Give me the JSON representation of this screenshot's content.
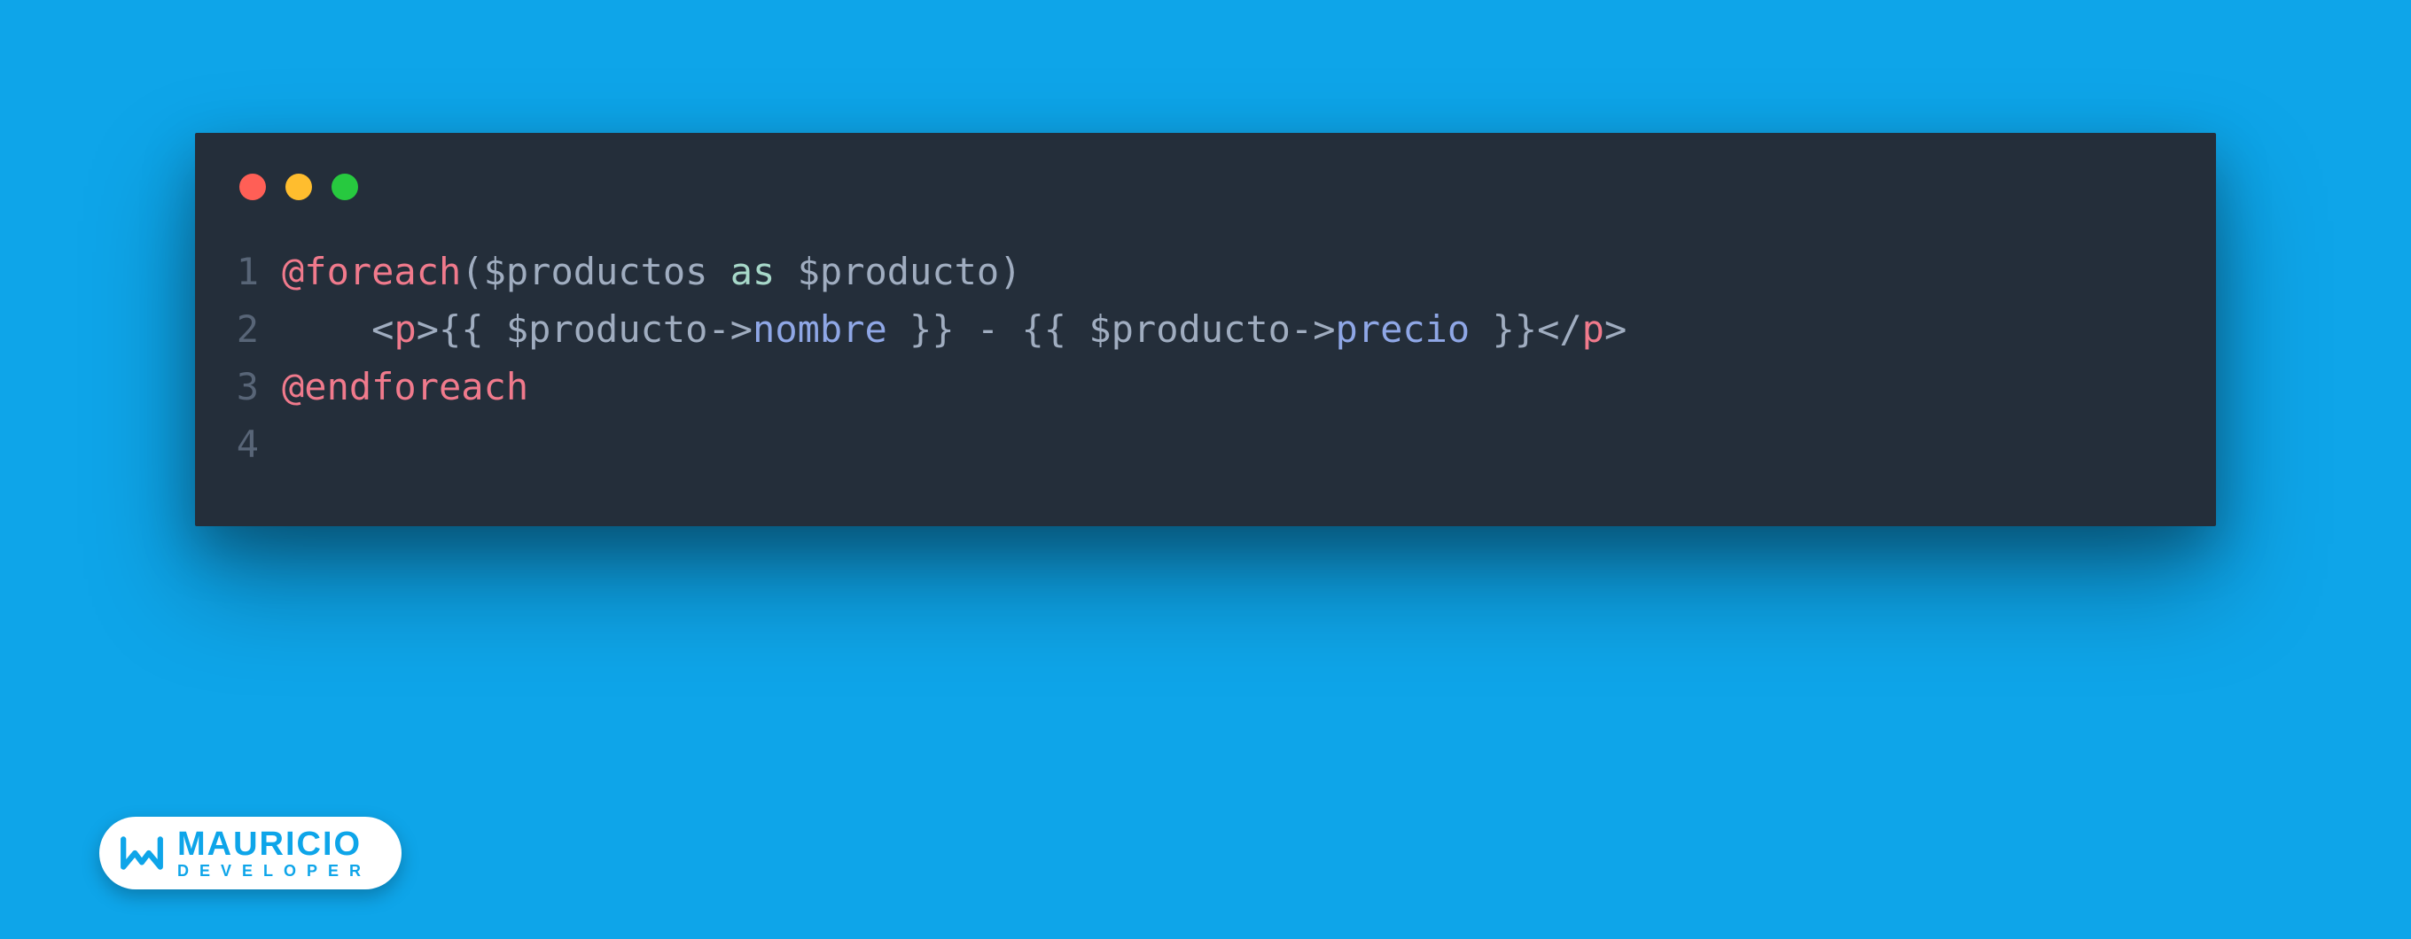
{
  "colors": {
    "page_bg": "#0ea5e9",
    "window_bg": "#242e3a",
    "traffic_red": "#ff5f56",
    "traffic_yellow": "#ffbd2e",
    "traffic_green": "#27c93f",
    "gutter": "#586577",
    "directive": "#f07a8c",
    "keyword": "#a7d8c9",
    "property": "#8fa7e6",
    "default": "#a0adc0"
  },
  "titlebar": {
    "buttons": [
      "close",
      "minimize",
      "zoom"
    ]
  },
  "code": {
    "lines": [
      {
        "n": "1",
        "indent": 0,
        "tokens": [
          {
            "t": "@foreach",
            "c": "tok-dir"
          },
          {
            "t": "(",
            "c": "tok-paren"
          },
          {
            "t": "$productos",
            "c": "tok-var"
          },
          {
            "t": " as ",
            "c": "tok-kw"
          },
          {
            "t": "$producto",
            "c": "tok-var"
          },
          {
            "t": ")",
            "c": "tok-paren"
          }
        ]
      },
      {
        "n": "2",
        "indent": 1,
        "tokens": [
          {
            "t": "<",
            "c": "tok-tag-br"
          },
          {
            "t": "p",
            "c": "tok-tag"
          },
          {
            "t": ">",
            "c": "tok-tag-br"
          },
          {
            "t": "{{ ",
            "c": "tok-mst"
          },
          {
            "t": "$producto",
            "c": "tok-var"
          },
          {
            "t": "->",
            "c": "tok-arrow"
          },
          {
            "t": "nombre",
            "c": "tok-prop"
          },
          {
            "t": " }}",
            "c": "tok-mst"
          },
          {
            "t": " - ",
            "c": "tok-plain"
          },
          {
            "t": "{{ ",
            "c": "tok-mst"
          },
          {
            "t": "$producto",
            "c": "tok-var"
          },
          {
            "t": "->",
            "c": "tok-arrow"
          },
          {
            "t": "precio",
            "c": "tok-prop"
          },
          {
            "t": " }}",
            "c": "tok-mst"
          },
          {
            "t": "</",
            "c": "tok-tag-br"
          },
          {
            "t": "p",
            "c": "tok-tag"
          },
          {
            "t": ">",
            "c": "tok-tag-br"
          }
        ]
      },
      {
        "n": "3",
        "indent": 0,
        "tokens": [
          {
            "t": "@endforeach",
            "c": "tok-dir"
          }
        ]
      },
      {
        "n": "4",
        "indent": 0,
        "tokens": []
      }
    ]
  },
  "brand": {
    "name": "MAURICIO",
    "subtitle": "DEVELOPER"
  }
}
